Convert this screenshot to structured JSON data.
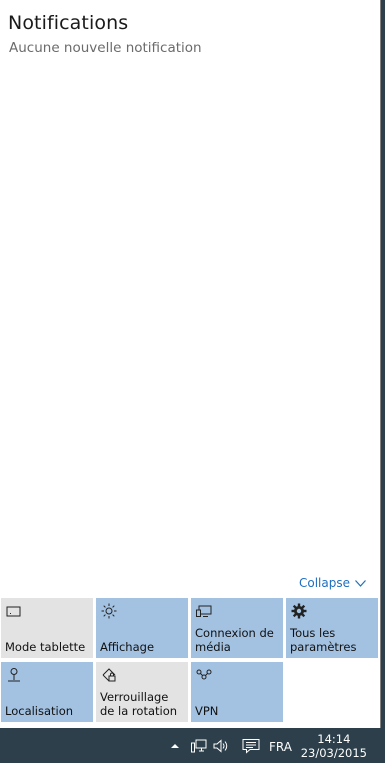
{
  "action_center": {
    "title": "Notifications",
    "empty_message": "Aucune nouvelle notification",
    "collapse_label": "Collapse",
    "tiles": [
      {
        "label": "Mode tablette",
        "icon": "tablet-mode-icon",
        "state": "off"
      },
      {
        "label": "Affichage",
        "icon": "brightness-icon",
        "state": "on"
      },
      {
        "label": "Connexion de média",
        "icon": "media-connect-icon",
        "state": "on"
      },
      {
        "label": "Tous les paramètres",
        "icon": "gear-icon",
        "state": "on"
      },
      {
        "label": "Localisation",
        "icon": "location-icon",
        "state": "on"
      },
      {
        "label": "Verrouillage de la rotation",
        "icon": "rotation-lock-icon",
        "state": "off"
      },
      {
        "label": "VPN",
        "icon": "vpn-icon",
        "state": "on"
      }
    ]
  },
  "taskbar": {
    "language": "FRA",
    "time": "14:14",
    "date": "23/03/2015"
  },
  "colors": {
    "tile_on": "#a3c2e2",
    "tile_off": "#e3e3e3",
    "taskbar": "#2c3f4a",
    "link": "#1f6fbf"
  }
}
